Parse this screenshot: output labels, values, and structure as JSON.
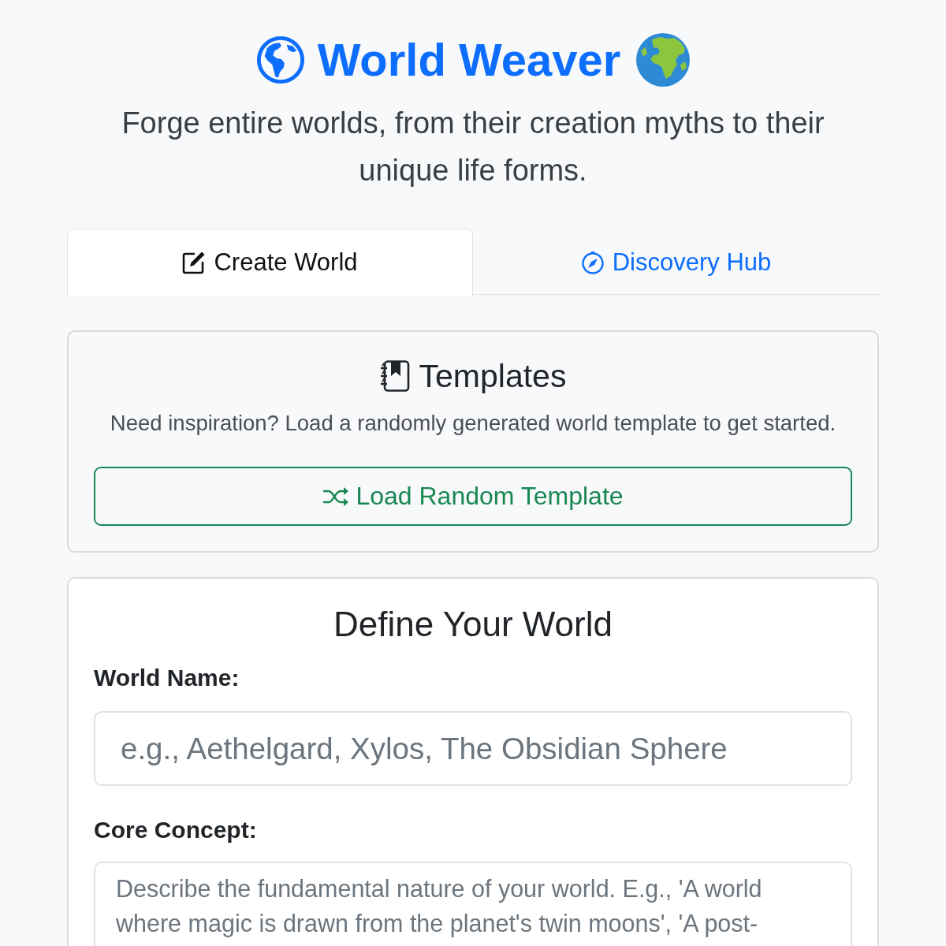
{
  "header": {
    "title": "World Weaver",
    "subtitle": "Forge entire worlds, from their creation myths to their unique life forms."
  },
  "tabs": [
    {
      "label": "Create World",
      "kind": "edit",
      "selected": true
    },
    {
      "label": "Discovery Hub",
      "kind": "compass",
      "selected": false
    }
  ],
  "templates": {
    "title": "Templates",
    "description": "Need inspiration? Load a randomly generated world template to get started.",
    "button": "Load Random Template"
  },
  "form": {
    "title": "Define Your World",
    "fields": [
      {
        "label": "World Name:",
        "kind": "input",
        "placeholder": "e.g., Aethelgard, Xylos, The Obsidian Sphere"
      },
      {
        "label": "Core Concept:",
        "kind": "textarea",
        "placeholder": "Describe the fundamental nature of your world. E.g., 'A world where magic is drawn from the planet's twin moons', 'A post-"
      }
    ]
  }
}
